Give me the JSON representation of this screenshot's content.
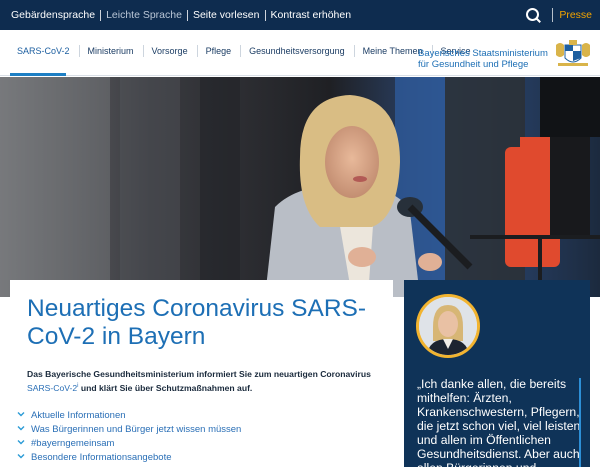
{
  "topbar": {
    "links": [
      "Gebärdensprache",
      "Leichte Sprache",
      "Seite vorlesen",
      "Kontrast erhöhen"
    ],
    "presse": "Presse"
  },
  "nav": {
    "items": [
      "SARS-CoV-2",
      "Ministerium",
      "Vorsorge",
      "Pflege",
      "Gesundheitsversorgung",
      "Meine Themen",
      "Service"
    ],
    "active": "SARS-CoV-2",
    "ministry_name": "Bayerisches Staatsministerium für Gesundheit und Pflege"
  },
  "card": {
    "title": "Neuartiges Coronavirus SARS-CoV-2 in Bayern",
    "intro_before": "Das Bayerische Gesundheitsministerium informiert Sie zum neuartigen Coronavirus ",
    "intro_link": "SARS-CoV-2",
    "intro_sup": "i",
    "intro_after": " und klärt Sie über Schutzmaßnahmen auf.",
    "links": [
      "Aktuelle Informationen",
      "Was Bürgerinnen und Bürger jetzt wissen müssen",
      "#bayerngemeinsam",
      "Besondere Informationsangebote"
    ]
  },
  "quote": {
    "text": "„Ich danke allen, die bereits mithelfen: Ärzten, Krankenschwestern, Pflegern, die jetzt schon viel, viel leisten und allen im Öffentlichen Gesundheitsdienst. Aber auch allen Bürgerinnen und"
  },
  "colors": {
    "topbar": "#0e2c4f",
    "accent_blue": "#1d6fb5",
    "presse": "#f2a400",
    "quote_bg": "#0f3358"
  }
}
